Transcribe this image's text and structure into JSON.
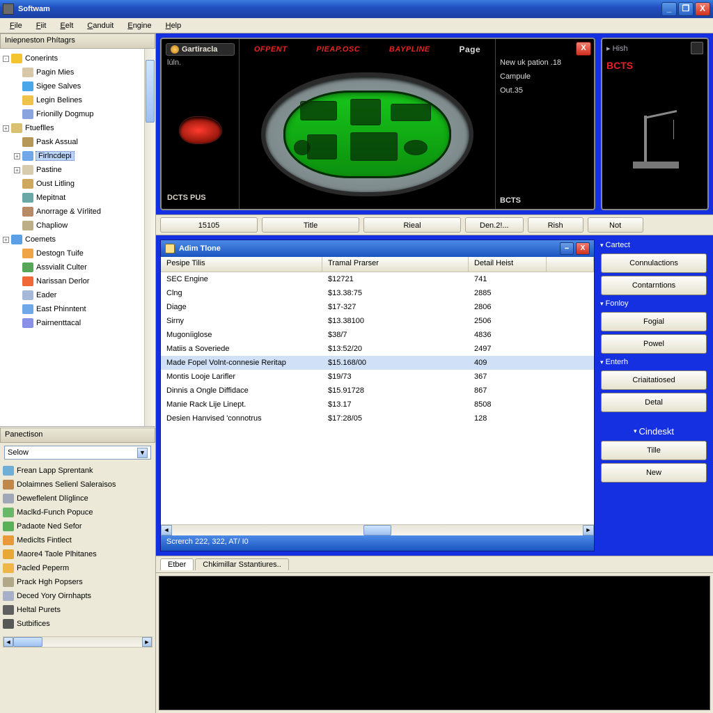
{
  "title": "Softwam",
  "menu": [
    "File",
    "Fiit",
    "Eelt",
    "Canduit",
    "Engine",
    "Help"
  ],
  "menu_u": [
    "F",
    "F",
    "E",
    "C",
    "E",
    "H"
  ],
  "left": {
    "header": "Iniepneston Phítagrs",
    "tree": [
      {
        "d": 0,
        "t": "-",
        "c": "#f4c430",
        "l": "Conerints"
      },
      {
        "d": 1,
        "t": "",
        "c": "#d7c8a8",
        "l": "Pagin Mies"
      },
      {
        "d": 1,
        "t": "",
        "c": "#4aa6e8",
        "l": "Sigee Salves"
      },
      {
        "d": 1,
        "t": "",
        "c": "#f0c24a",
        "l": "Legin Belines"
      },
      {
        "d": 1,
        "t": "",
        "c": "#8aa4e0",
        "l": "Frionilly Dogmup"
      },
      {
        "d": 0,
        "t": "+",
        "c": "#d8c070",
        "l": "Ftueflles"
      },
      {
        "d": 1,
        "t": "",
        "c": "#b89858",
        "l": "Pask Assual"
      },
      {
        "d": 1,
        "t": "+",
        "c": "#6fa8e8",
        "l": "Firlncdepi",
        "sel": true
      },
      {
        "d": 1,
        "t": "+",
        "c": "#d8ccae",
        "l": "Pastine"
      },
      {
        "d": 1,
        "t": "",
        "c": "#cfa860",
        "l": "Oust Litling"
      },
      {
        "d": 1,
        "t": "",
        "c": "#6aa8a8",
        "l": "Mepitnat"
      },
      {
        "d": 1,
        "t": "",
        "c": "#b88a68",
        "l": "Anorrage & Vírlited"
      },
      {
        "d": 1,
        "t": "",
        "c": "#bcae86",
        "l": "Chapliow"
      },
      {
        "d": 0,
        "t": "+",
        "c": "#5aa0e6",
        "l": "Coemets"
      },
      {
        "d": 1,
        "t": "",
        "c": "#f0a448",
        "l": "Destogn Tuife"
      },
      {
        "d": 1,
        "t": "",
        "c": "#58a658",
        "l": "Assvialit Culter"
      },
      {
        "d": 1,
        "t": "",
        "c": "#f06838",
        "l": "Narissan Derlor"
      },
      {
        "d": 1,
        "t": "",
        "c": "#a8b8d8",
        "l": "Eader"
      },
      {
        "d": 1,
        "t": "",
        "c": "#6fa8e8",
        "l": "East Phinntent"
      },
      {
        "d": 1,
        "t": "",
        "c": "#8a90e6",
        "l": "Pairnenttacal"
      }
    ],
    "lowhdr": "Panectison",
    "select": "Selow",
    "lowlist": [
      {
        "c": "#6faed6",
        "l": "Frean Lapp Sprentank"
      },
      {
        "c": "#c08848",
        "l": "Dolaimnes Selienl Saleraisos"
      },
      {
        "c": "#a0a8b8",
        "l": "Deweflelent Dlíglince"
      },
      {
        "c": "#68b868",
        "l": "Maclkd-Funch Popuce"
      },
      {
        "c": "#58b058",
        "l": "Padaote Ned Sefor"
      },
      {
        "c": "#e89a3a",
        "l": "Mediclts Fintlect"
      },
      {
        "c": "#e8a838",
        "l": "Maore4 Taole Plhitanes"
      },
      {
        "c": "#eeb648",
        "l": "Pacled Peperm"
      },
      {
        "c": "#b0a888",
        "l": "Prack Hgh Popsers"
      },
      {
        "c": "#a8b0c8",
        "l": "Deced Yory Oirnhapts"
      },
      {
        "c": "#606060",
        "l": "Heltal Purets"
      },
      {
        "c": "#585858",
        "l": "Sutbifices"
      }
    ]
  },
  "bigcard": {
    "tag": "Gartiracla",
    "sub": "lúln.",
    "bottom": "DCTS PUS",
    "red": [
      "OFPENT",
      "PIEAP.OSC",
      "BAYPLINE"
    ],
    "page": "Page",
    "right": [
      "New uk pation .18",
      "Campule",
      "Out.35",
      "BCTS"
    ]
  },
  "smallcard": {
    "t": "Hish",
    "r": "BCTS"
  },
  "tabs": [
    "15105",
    "Title",
    "Rieal",
    "Den.2!...",
    "Rish",
    "Not"
  ],
  "subwin": {
    "title": "Adim Tlone",
    "headers": [
      "Pesipe Tilis",
      "Tramal Prarser",
      "Detail Heist",
      ""
    ],
    "rows": [
      [
        "SEC Engine",
        "$12721",
        "741"
      ],
      [
        "Clng",
        "$13.38:75",
        "2885"
      ],
      [
        "Diage",
        "$17-327",
        "2806"
      ],
      [
        "Sirny",
        "$13.38100",
        "2506"
      ],
      [
        "Mugoníiglose",
        "$38/7",
        "4836"
      ],
      [
        "Matiis a Soveriede",
        "$13:52/20",
        "2497"
      ],
      [
        "Made Fopel Volnt-connesie Reritap",
        "$15.168/00",
        "409"
      ],
      [
        "Montis Looje Larifler",
        "$19/73",
        "367"
      ],
      [
        "Dinnis a Ongle Diffidace",
        "$15.91728",
        "867"
      ],
      [
        "Manie Rack Lije Linept.",
        "$13.17",
        "8508"
      ],
      [
        "Desien Hanvised 'connotrus",
        "$17:28/05",
        "128"
      ]
    ],
    "selected": 6,
    "status": "Screrch 222, 322, AT/ I0"
  },
  "rpanel": [
    {
      "h": "Cartect",
      "b": [
        "Connulactions",
        "Contarntions"
      ]
    },
    {
      "h": "Fonloy",
      "b": [
        "Fogial",
        "Powel"
      ]
    },
    {
      "h": "Enterh",
      "b": [
        "Criaitatiosed",
        "Detal"
      ]
    },
    {
      "h": "Cindeskt",
      "b": [
        "Tille",
        "New"
      ],
      "nohead": true
    }
  ],
  "bottab": [
    "Etber",
    "Chkimillar Sstantiures.."
  ]
}
